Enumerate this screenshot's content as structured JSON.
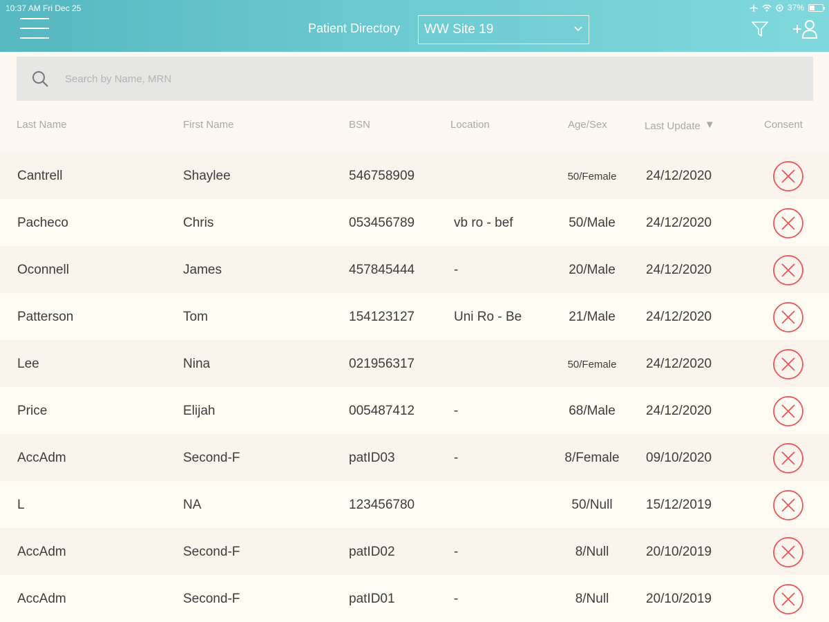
{
  "status_bar": {
    "time": "10:37 AM  Fri Dec 25",
    "battery": "37%",
    "battery_level": 0.37
  },
  "header": {
    "title": "Patient Directory",
    "site": "WW Site 19"
  },
  "search": {
    "placeholder": "Search by Name, MRN"
  },
  "columns": {
    "last_name": "Last Name",
    "first_name": "First Name",
    "bsn": "BSN",
    "location": "Location",
    "age_sex": "Age/Sex",
    "last_update": "Last Update",
    "consent": "Consent"
  },
  "rows": [
    {
      "last": "Cantrell",
      "first": "Shaylee",
      "bsn": "546758909",
      "location": "",
      "age_sex": "50/Female",
      "date": "24/12/2020"
    },
    {
      "last": "Pacheco",
      "first": "Chris",
      "bsn": "053456789",
      "location": "vb ro - bef",
      "age_sex": "50/Male",
      "date": "24/12/2020"
    },
    {
      "last": "Oconnell",
      "first": "James",
      "bsn": "457845444",
      "location": "-",
      "age_sex": "20/Male",
      "date": "24/12/2020"
    },
    {
      "last": "Patterson",
      "first": "Tom",
      "bsn": "154123127",
      "location": "Uni Ro - Be",
      "age_sex": "21/Male",
      "date": "24/12/2020"
    },
    {
      "last": "Lee",
      "first": "Nina",
      "bsn": "021956317",
      "location": "",
      "age_sex": "50/Female",
      "date": "24/12/2020"
    },
    {
      "last": "Price",
      "first": "Elijah",
      "bsn": "005487412",
      "location": "-",
      "age_sex": "68/Male",
      "date": "24/12/2020"
    },
    {
      "last": "AccAdm",
      "first": "Second-F",
      "bsn": "patID03",
      "location": "-",
      "age_sex": "8/Female",
      "date": "09/10/2020"
    },
    {
      "last": "L",
      "first": "NA",
      "bsn": "123456780",
      "location": "",
      "age_sex": "50/Null",
      "date": "15/12/2019"
    },
    {
      "last": "AccAdm",
      "first": "Second-F",
      "bsn": "patID02",
      "location": "-",
      "age_sex": "8/Null",
      "date": "20/10/2019"
    },
    {
      "last": "AccAdm",
      "first": "Second-F",
      "bsn": "patID01",
      "location": "-",
      "age_sex": "8/Null",
      "date": "20/10/2019"
    }
  ],
  "icons": {
    "menu": "hamburger-icon",
    "dropdown": "chevron-down-icon",
    "filter": "filter-icon",
    "add_patient": "add-user-icon",
    "search": "search-icon",
    "consent": "x-circle-icon"
  },
  "colors": {
    "header_start": "#56b7c0",
    "header_end": "#7fd9dc",
    "consent_red": "#e8545a"
  }
}
